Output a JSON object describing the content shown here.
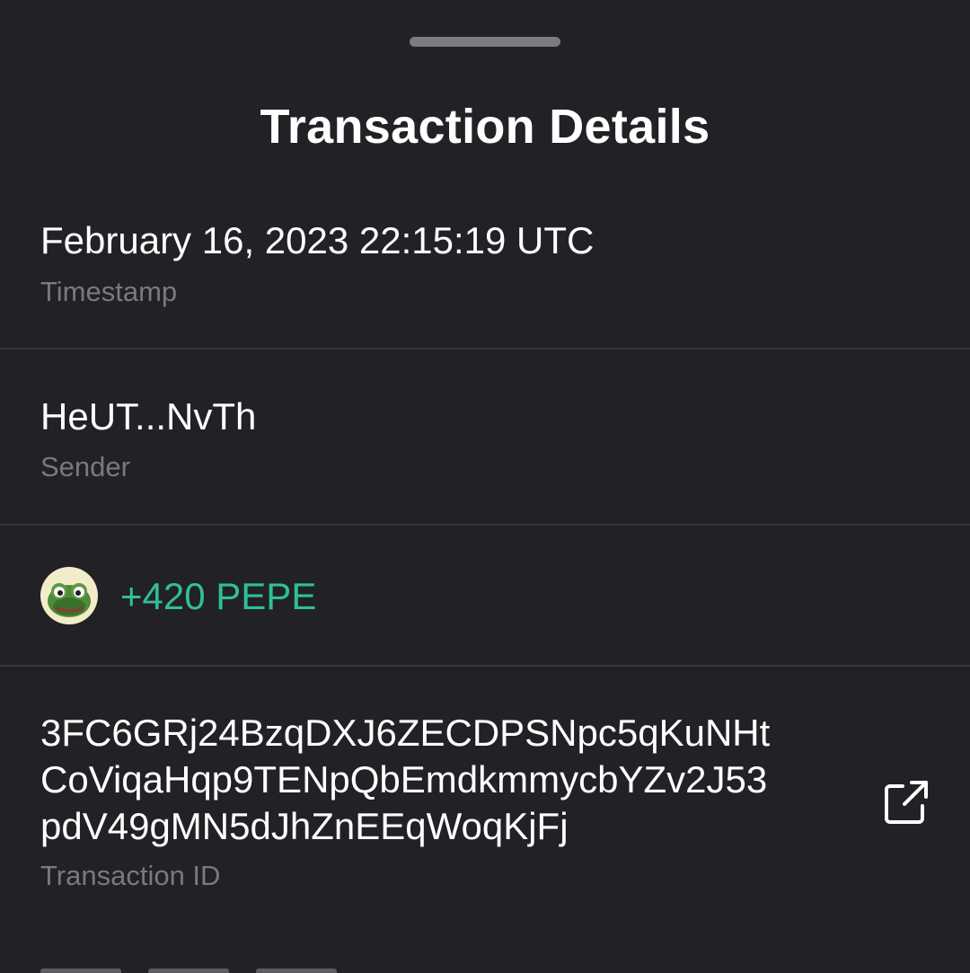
{
  "sheet": {
    "title": "Transaction Details"
  },
  "timestamp": {
    "value": "February 16, 2023 22:15:19 UTC",
    "label": "Timestamp"
  },
  "sender": {
    "value": "HeUT...NvTh",
    "label": "Sender"
  },
  "transfer": {
    "amount": "+420 PEPE",
    "icon": "pepe-token-icon",
    "amount_color": "#2fbf99"
  },
  "transaction": {
    "id": "3FC6GRj24BzqDXJ6ZECDPSNpc5qKuNHt\nCoViqaHqp9TENpQbEmdkmmycbYZv2J53\npdV49gMN5dJhZnEEqWoqKjFj",
    "label": "Transaction ID",
    "link_icon": "external-link-icon"
  },
  "colors": {
    "background": "#222125",
    "divider": "#38373b",
    "label": "#7a797e",
    "accent": "#2fbf99"
  }
}
